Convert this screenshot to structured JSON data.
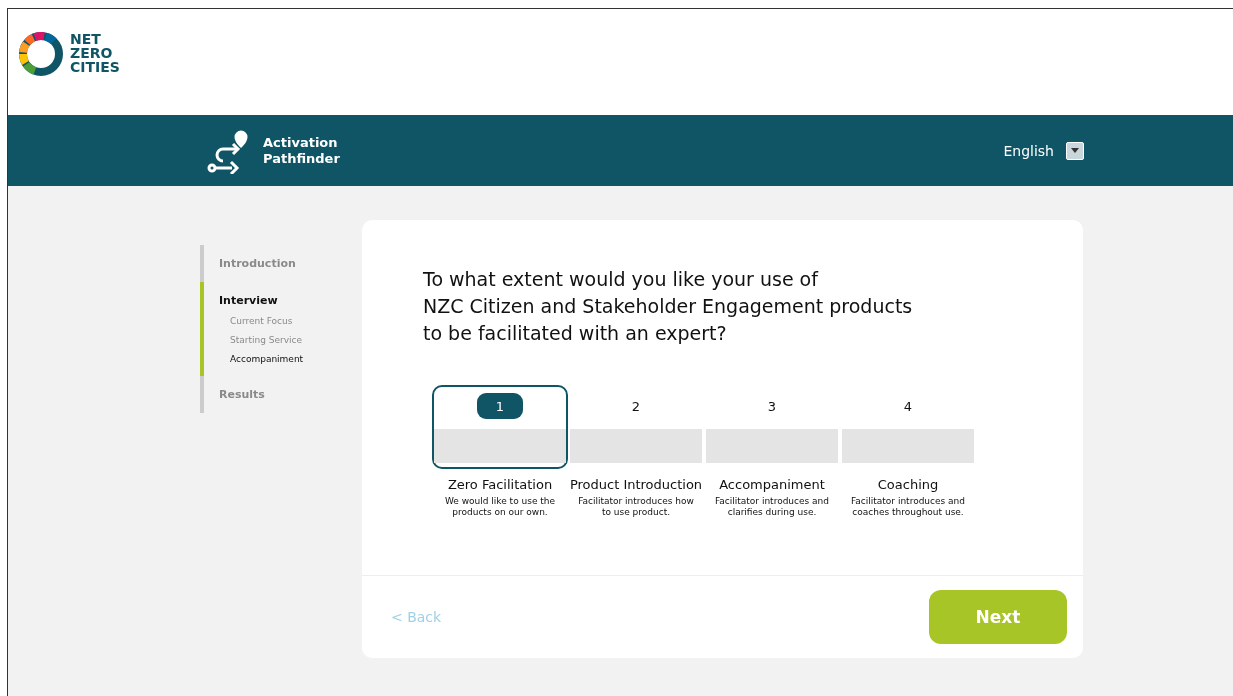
{
  "logo": {
    "lines": [
      "NET",
      "ZERO",
      "CITIES"
    ]
  },
  "header": {
    "app_title": [
      "Activation",
      "Pathfinder"
    ],
    "language": "English"
  },
  "sidebar": {
    "sections": [
      {
        "label": "Introduction",
        "selected": false
      },
      {
        "label": "Interview",
        "selected": true,
        "children": [
          {
            "label": "Current Focus",
            "selected": false
          },
          {
            "label": "Starting Service",
            "selected": false
          },
          {
            "label": "Accompaniment",
            "selected": true
          }
        ]
      },
      {
        "label": "Results",
        "selected": false
      }
    ]
  },
  "question": {
    "lines": [
      "To what extent would you like your use of",
      "NZC Citizen and Stakeholder Engagement products",
      "to be facilitated with an expert?"
    ]
  },
  "options": [
    {
      "number": "1",
      "title": "Zero Facilitation",
      "description": "We would like to use the products on our own.",
      "selected": true
    },
    {
      "number": "2",
      "title": "Product Introduction",
      "description": "Facilitator introduces how to use product.",
      "selected": false
    },
    {
      "number": "3",
      "title": "Accompaniment",
      "description": "Facilitator introduces and clarifies during use.",
      "selected": false
    },
    {
      "number": "4",
      "title": "Coaching",
      "description": "Facilitator introduces and coaches throughout use.",
      "selected": false
    }
  ],
  "footer": {
    "back": "< Back",
    "next": "Next"
  }
}
